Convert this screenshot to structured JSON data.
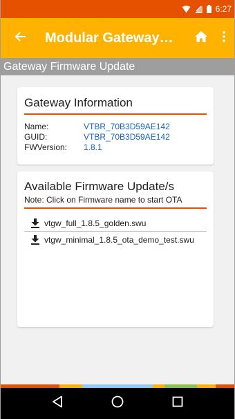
{
  "status_bar": {
    "time": "6:27",
    "icons": [
      "wifi-icon",
      "signal-icon",
      "battery-icon"
    ]
  },
  "app_bar": {
    "title": "Modular Gateway…",
    "back_icon": "arrow-left-icon",
    "home_icon": "home-icon",
    "more_icon": "more-vert-icon"
  },
  "section_header": "Gateway Firmware Update",
  "gateway_info": {
    "title": "Gateway Information",
    "rows": [
      {
        "label": "Name:",
        "value": "VTBR_70B3D59AE142"
      },
      {
        "label": "GUID:",
        "value": "VTBR_70B3D59AE142"
      },
      {
        "label": "FWVersion:",
        "value": "1.8.1"
      }
    ]
  },
  "firmware_updates": {
    "title": "Available Firmware Update/s",
    "note": "Note: Click on Firmware name to start OTA",
    "items": [
      {
        "name": "vtgw_full_1.8.5_golden.swu",
        "icon": "download-icon"
      },
      {
        "name": "vtgw_minimal_1.8.5_ota_demo_test.swu",
        "icon": "download-icon"
      }
    ]
  },
  "nav_bar": {
    "buttons": [
      "back-triangle-icon",
      "home-circle-icon",
      "recents-square-icon"
    ]
  },
  "colors": {
    "status_bar": "#e65100",
    "app_bar": "#ffb300",
    "section_header": "#9e9e9e",
    "accent_line": "#e65100",
    "link_value": "#1565c0",
    "stripe": [
      "#e65100",
      "#ffb300",
      "#90caf9",
      "#ffb300",
      "#8bc34a",
      "#ffb300",
      "#e65100"
    ]
  }
}
